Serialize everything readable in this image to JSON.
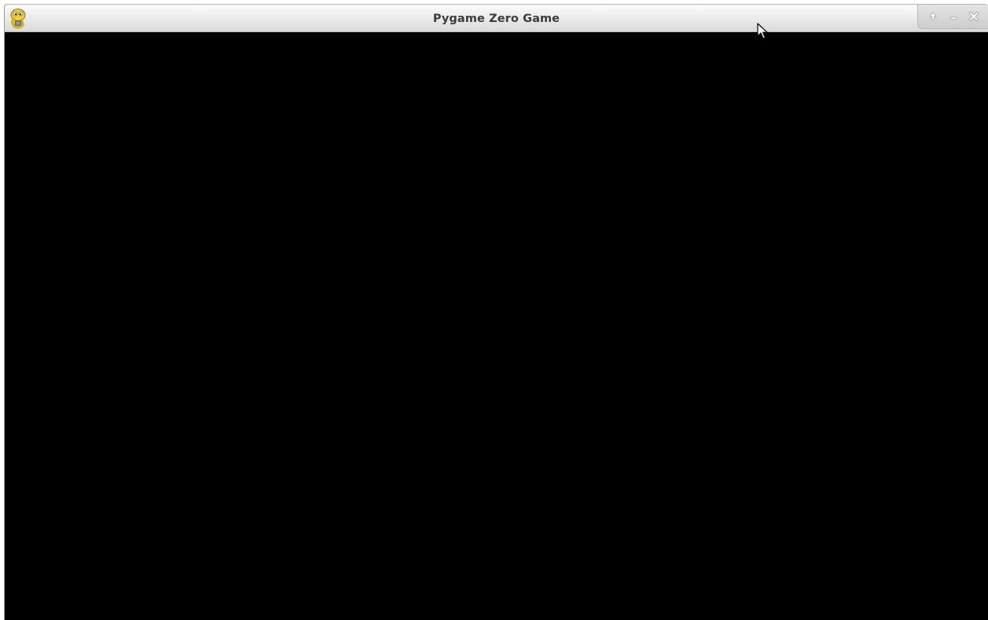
{
  "window": {
    "title": "Pygame Zero Game",
    "app_icon": "pygame-snake-icon",
    "controls": [
      {
        "name": "maximize",
        "icon": "arrow-up-icon"
      },
      {
        "name": "minimize",
        "icon": "minimize-icon"
      },
      {
        "name": "close",
        "icon": "close-icon"
      }
    ]
  },
  "canvas": {
    "background": "#000000"
  },
  "colors": {
    "titlebar": "#e9e9e9",
    "title_text": "#3c3c3c",
    "icon_yellow": "#f2d12a"
  }
}
